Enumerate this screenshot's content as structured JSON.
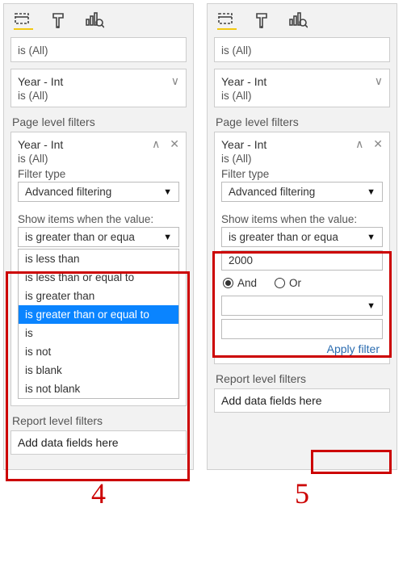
{
  "tabs": {
    "fields": "fields",
    "format": "format",
    "analytics": "analytics"
  },
  "common": {
    "is_all": "is (All)",
    "year_int": "Year - Int",
    "page_level_filters": "Page level filters",
    "report_level_filters": "Report level filters",
    "add_data_fields": "Add data fields here",
    "filter_type_label": "Filter type",
    "advanced_filtering": "Advanced filtering",
    "show_items_label": "Show items when the value:"
  },
  "left": {
    "operator_selected": "is greater than or equa",
    "options": {
      "o0": "is less than",
      "o1": "is less than or equal to",
      "o2": "is greater than",
      "o3": "is greater than or equal to",
      "o4": "is",
      "o5": "is not",
      "o6": "is blank",
      "o7": "is not blank"
    },
    "step": "4"
  },
  "right": {
    "operator_selected": "is greater than or equa",
    "value_entered": "2000",
    "and_label": "And",
    "or_label": "Or",
    "apply_label": "Apply filter",
    "step": "5"
  }
}
